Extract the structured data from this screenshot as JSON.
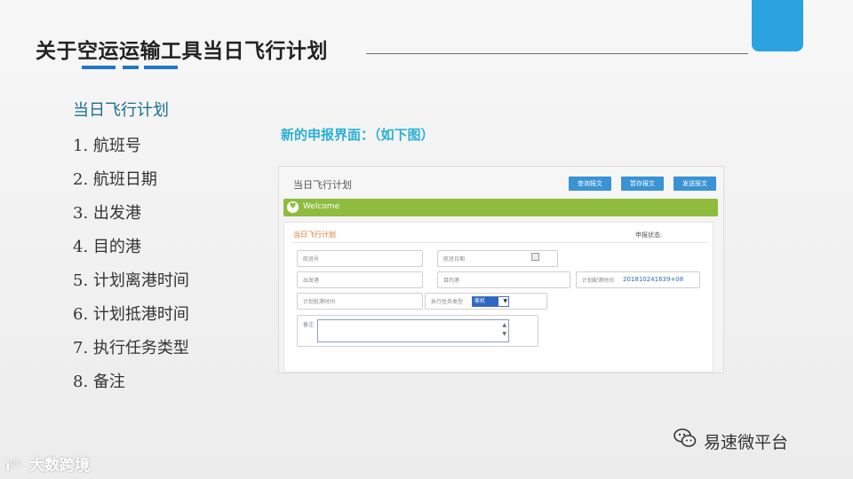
{
  "slide": {
    "title": "关于空运运输工具当日飞行计划",
    "underline_colors": [
      "#1f77c9",
      "#1f77c9",
      "#1f77c9",
      "#1f77c9"
    ]
  },
  "outline": {
    "heading": "当日飞行计划",
    "items": [
      "1. 航班号",
      "2. 航班日期",
      "3. 出发港",
      "4. 目的港",
      "5. 计划离港时间",
      "6. 计划抵港时间",
      "7. 执行任务类型",
      "8. 备注"
    ]
  },
  "caption": "新的申报界面：（如下图）",
  "app": {
    "title": "当日飞行计划",
    "buttons": [
      "查询报文",
      "暂存报文",
      "发送报文"
    ],
    "welcome": "Welcome",
    "form": {
      "title": "当日飞行计划",
      "status_label": "申报状态:",
      "fields": {
        "flight_no": "航班号",
        "flight_date": "航班日期",
        "departure": "出发港",
        "destination": "目的港",
        "plan_time_label": "计划配港时间",
        "plan_time_value": "201810241639+08",
        "plan_arrive": "计划抵港时间",
        "task_type_label": "执行任务类型",
        "task_type_value": "客机",
        "remark": "备注"
      }
    }
  },
  "watermarks": {
    "wechat": "易速微平台",
    "brand_logo": "ℹ⁰⁰",
    "brand": "大数跨境"
  },
  "colors": {
    "accent_blue": "#2aa3e0",
    "welcome_green": "#8fbc3f",
    "caption_cyan": "#2bb0d6",
    "button_blue": "#3a93d4"
  }
}
